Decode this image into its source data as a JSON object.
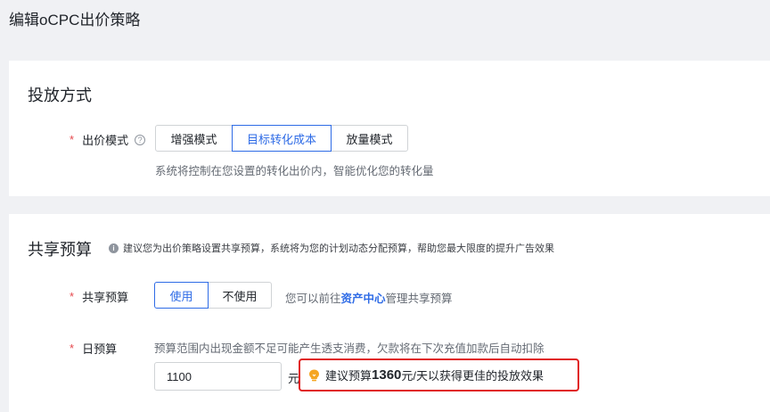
{
  "page": {
    "title": "编辑oCPC出价策略"
  },
  "bid_section": {
    "title": "投放方式",
    "mode_label": "出价模式",
    "required_mark": "*",
    "help_glyph": "?",
    "options": [
      "增强模式",
      "目标转化成本",
      "放量模式"
    ],
    "selected_option": "目标转化成本",
    "hint": "系统将控制在您设置的转化出价内，智能优化您的转化量"
  },
  "budget_section": {
    "title": "共享预算",
    "info_glyph": "i",
    "info_note": "建议您为出价策略设置共享预算，系统将为您的计划动态分配预算，帮助您最大限度的提升广告效果",
    "shared_label": "共享预算",
    "required_mark": "*",
    "shared_options": [
      "使用",
      "不使用"
    ],
    "shared_selected": "使用",
    "shared_hint_prefix": "您可以前往",
    "shared_hint_link": "资产中心",
    "shared_hint_suffix": "管理共享预算",
    "daily_label": "日预算",
    "daily_hint": "预算范围内出现金额不足可能产生透支消费，欠款将在下次充值加款后自动扣除",
    "daily_value": "1100",
    "unit": "元",
    "suggest_prefix": "建议预算",
    "suggest_amount": "1360",
    "suggest_suffix": "元/天以获得更佳的投放效果"
  },
  "colors": {
    "accent": "#2e6be6",
    "required": "#e5484d",
    "highlight_border": "#e02020",
    "bulb": "#f5a623"
  },
  "icons": {
    "help": "question-circle-icon",
    "info": "info-circle-icon",
    "suggest": "lightbulb-icon"
  }
}
